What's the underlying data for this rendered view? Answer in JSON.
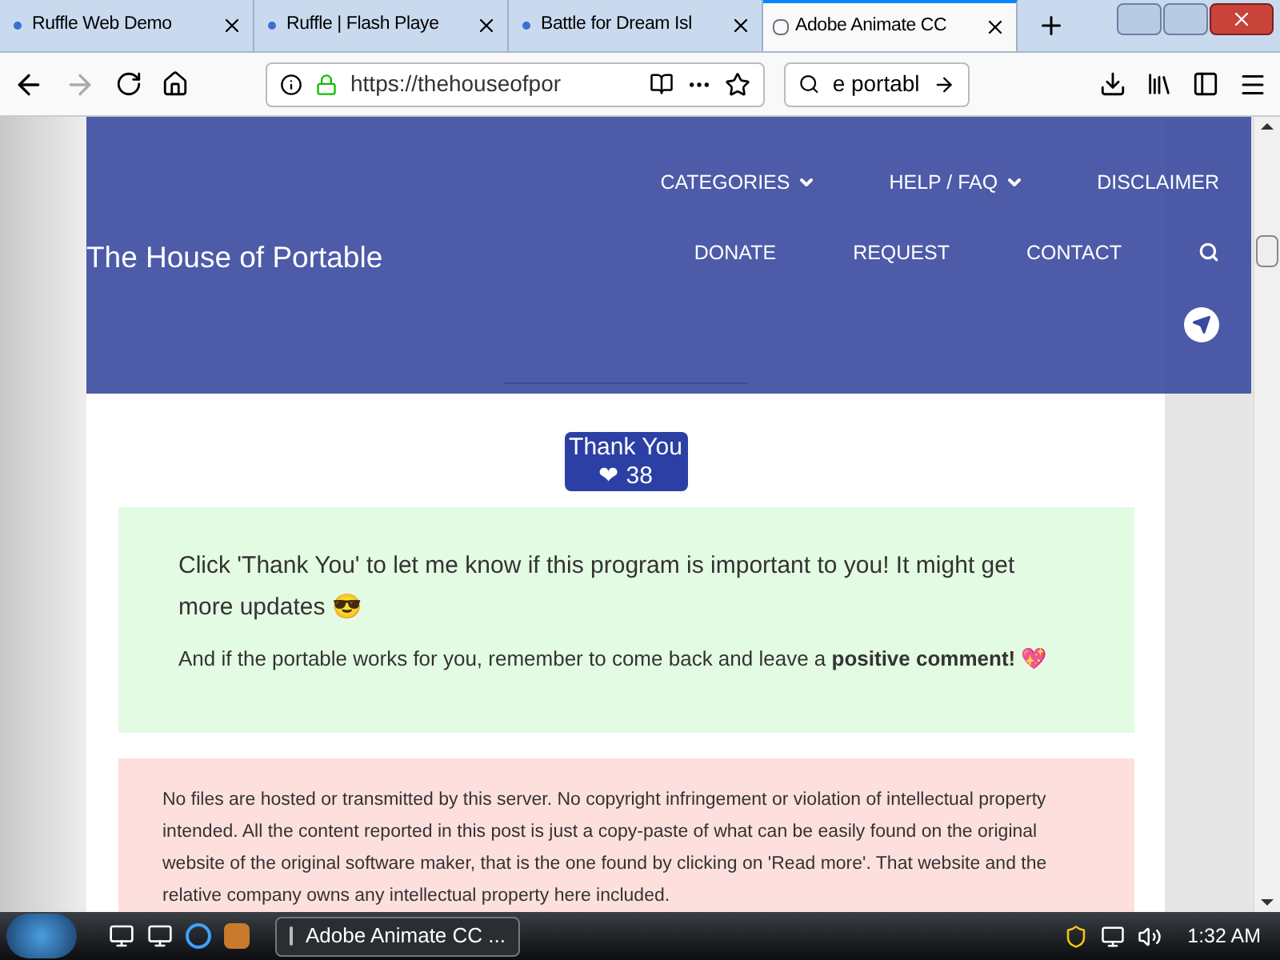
{
  "browser": {
    "tabs": [
      {
        "title": "Ruffle Web Demo",
        "selected": false
      },
      {
        "title": "Ruffle | Flash Playe",
        "selected": false
      },
      {
        "title": "Battle for Dream Isl",
        "selected": false
      },
      {
        "title": "Adobe Animate CC",
        "selected": true
      }
    ],
    "url": "https://thehouseofpor",
    "search": "e portabl"
  },
  "page": {
    "header": {
      "site_title": "The House of Portable",
      "nav_top": [
        {
          "label": "CATEGORIES",
          "dropdown": true
        },
        {
          "label": "HELP / FAQ",
          "dropdown": true
        },
        {
          "label": "DISCLAIMER",
          "dropdown": false
        }
      ],
      "nav_bottom": [
        "DONATE",
        "REQUEST",
        "CONTACT"
      ]
    },
    "thank_button": {
      "label": "Thank You",
      "count": "❤ 38"
    },
    "notice": {
      "line1": "Click 'Thank You' to let me know if this program is important to you! It might get more updates 😎",
      "line2": "And if the portable works for you, remember to come back and leave a **positive comment!** 💖"
    },
    "disclaimer": "No files are hosted or transmitted by this server. No copyright infringement or violation of intellectual property intended. All the content reported in this post is just a copy-paste of what can be easily found on the original website of the original software maker, that is the one found by clicking on 'Read more'. That website and the relative company owns any intellectual property here included."
  },
  "taskbar": {
    "task": "Adobe Animate CC ...",
    "time": "1:32 AM"
  }
}
